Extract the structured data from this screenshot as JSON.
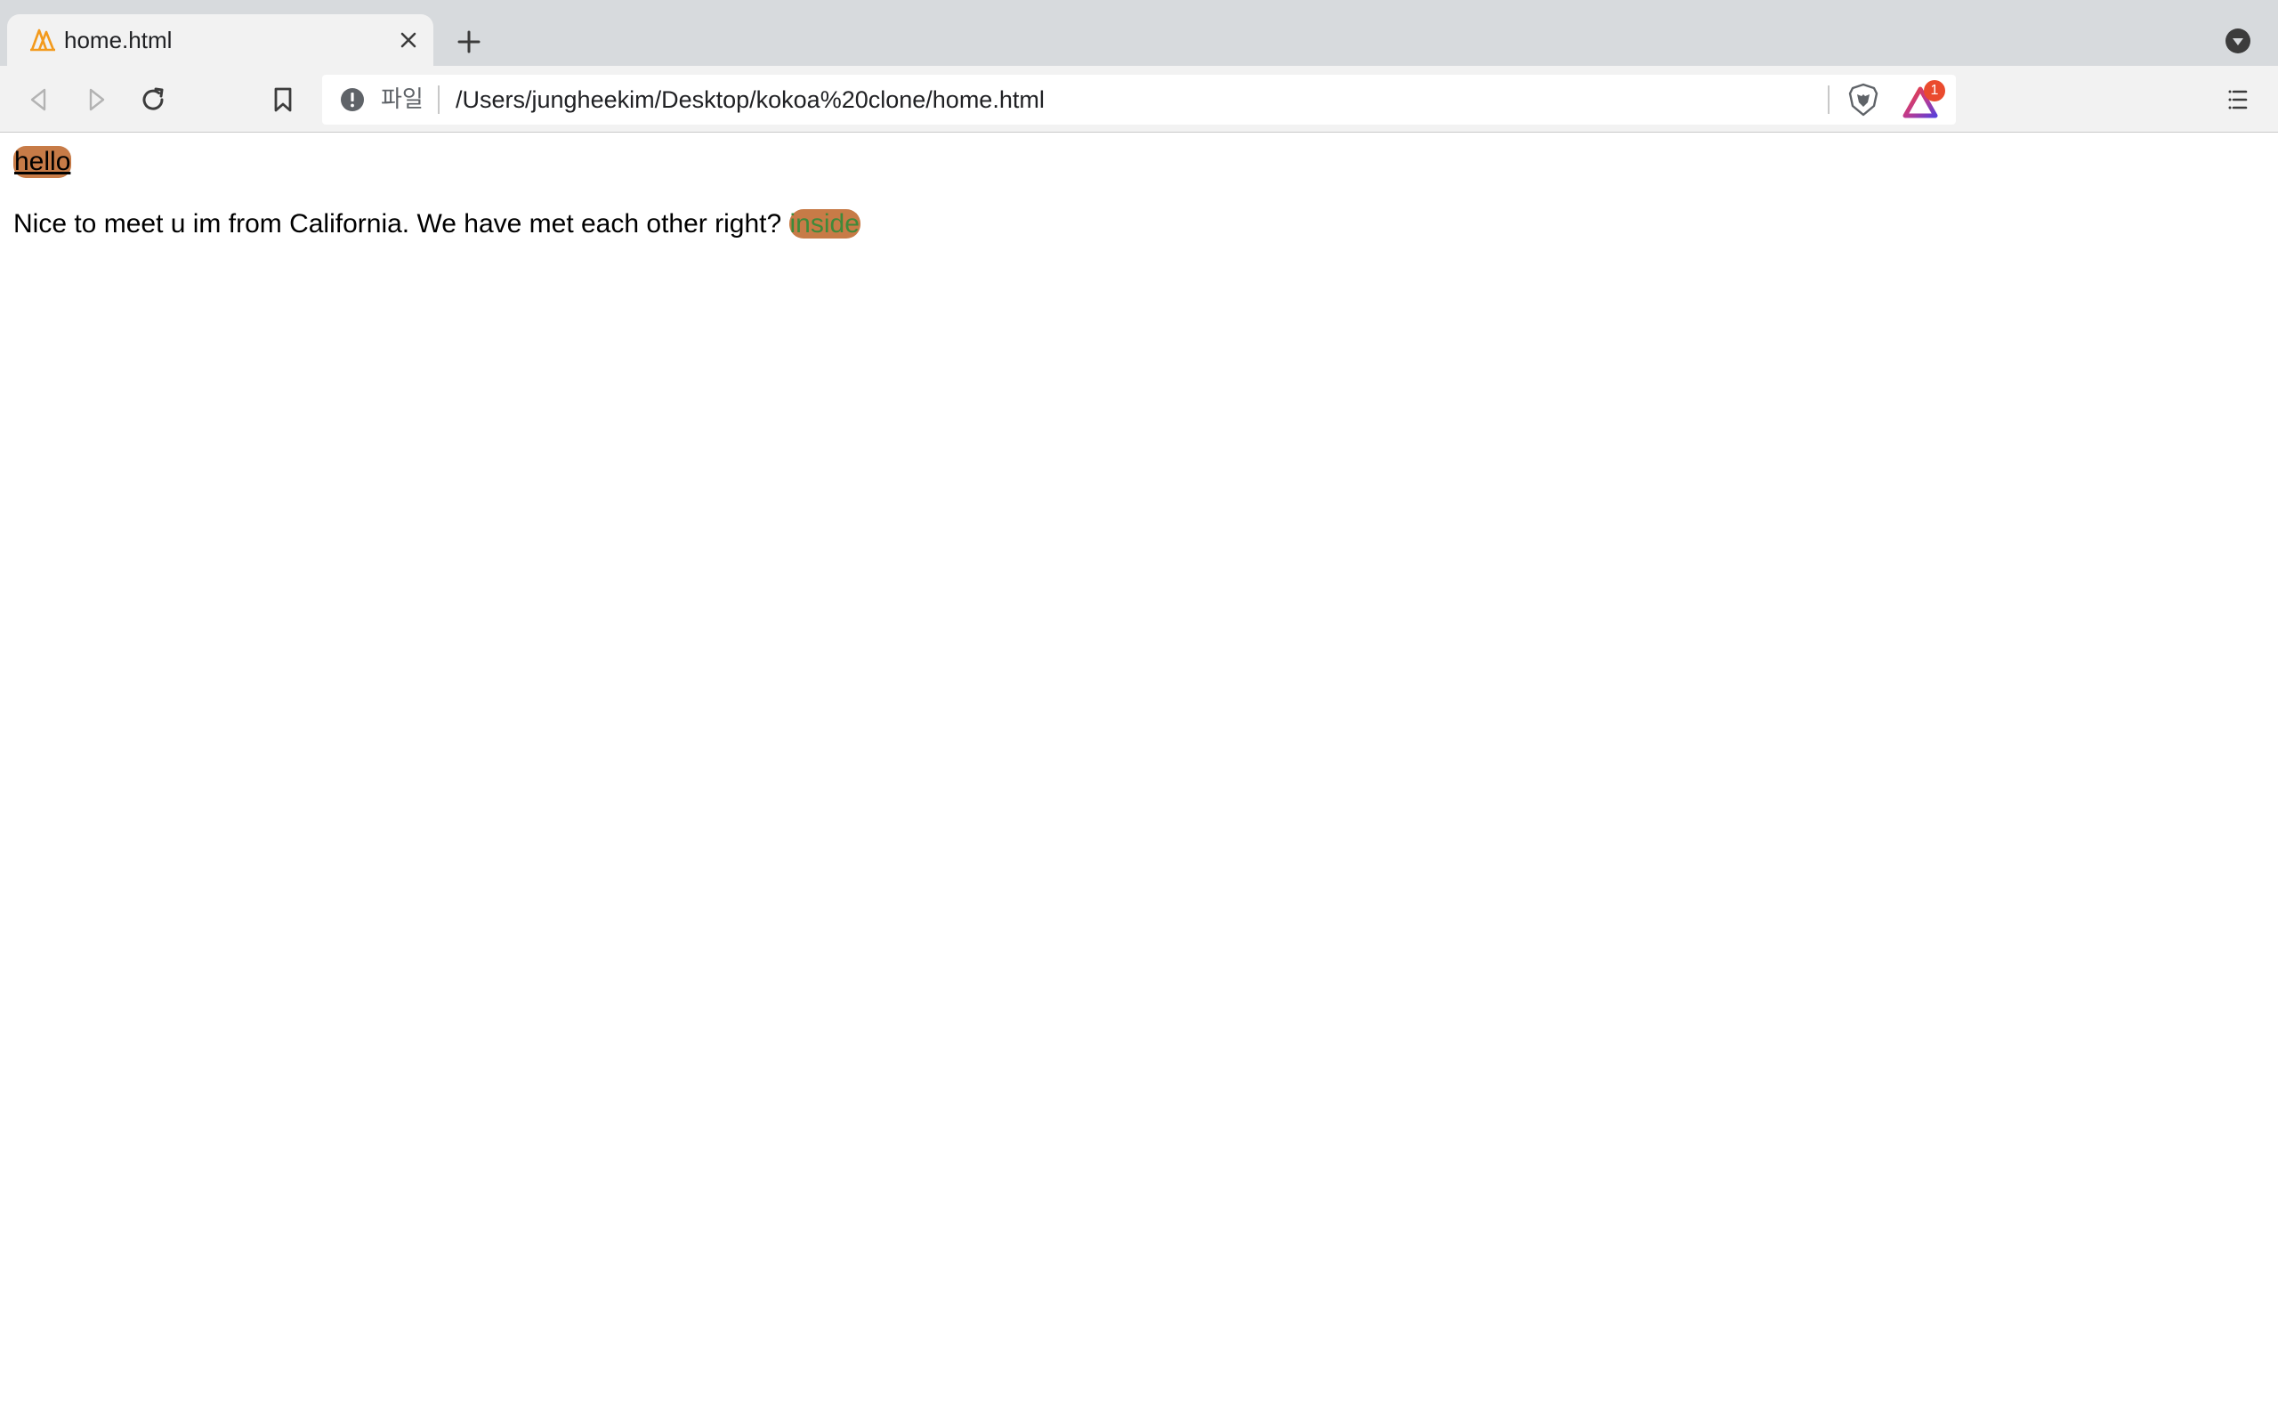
{
  "browser": {
    "tab": {
      "title": "home.html"
    },
    "toolbar": {
      "scheme_label": "파일",
      "url": "/Users/jungheekim/Desktop/kokoa%20clone/home.html",
      "rewards_badge_count": "1"
    }
  },
  "page": {
    "hello_text": "hello",
    "paragraph_text": "Nice to meet u im from California. We have met each other right?",
    "inside_text": "inside"
  },
  "colors": {
    "highlight_background": "#c77b47",
    "inside_text_color": "#3f8a3a",
    "favicon_orange": "#f39a1c"
  },
  "icons": [
    "brave-favicon-icon",
    "close-icon",
    "plus-icon",
    "tab-search-icon",
    "back-icon",
    "forward-icon",
    "reload-icon",
    "bookmark-icon",
    "info-icon",
    "brave-shields-icon",
    "brave-rewards-icon",
    "menu-icon"
  ]
}
